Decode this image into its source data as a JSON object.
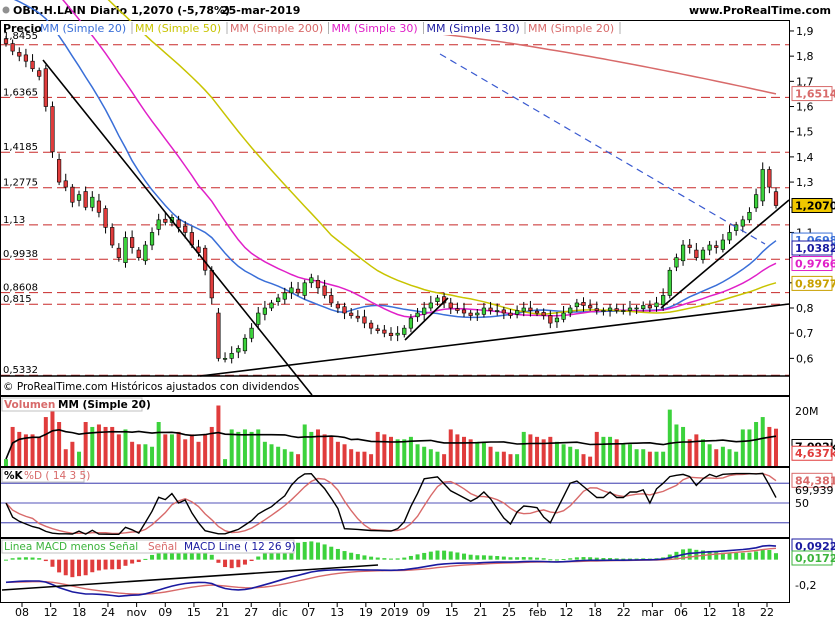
{
  "header": {
    "symbol": "OBR.H.LAIN",
    "period": "Diario",
    "last": "1,2070 (-5,78%)",
    "date": "25-mar-2019",
    "site": "www.ProRealTime.com"
  },
  "price_panel": {
    "title": "Precio",
    "legend": [
      {
        "label": "MM (Simple 20)",
        "color": "#3a6fd8"
      },
      {
        "label": "MM (Simple 50)",
        "color": "#c8c400"
      },
      {
        "label": "MM (Simple 200)",
        "color": "#d86a6a"
      },
      {
        "label": "MM (Simple 30)",
        "color": "#e020c8"
      },
      {
        "label": "MM (Simple 130)",
        "color": "#1a1aa0"
      },
      {
        "label": "MM (Simple 20)",
        "color": "#d86a6a"
      }
    ],
    "footer": "© ProRealTime.com  Históricos ajustados con dividendos",
    "axis_ticks": [
      "1,9",
      "1,8",
      "1,7",
      "1,6",
      "1,5",
      "1,4",
      "1,3",
      "1,2",
      "1,1",
      "1",
      "0,9",
      "0,8",
      "0,7",
      "0,6"
    ],
    "level_labels": [
      "1,6365",
      "1,4185",
      "1,2775",
      "1,13",
      "0,9938",
      "0,8608",
      "0,815",
      "0,5332"
    ],
    "level_partial": "1,8455",
    "tags": [
      {
        "text": "1,6514",
        "color": "#d86a6a",
        "fill": "#ffffff"
      },
      {
        "text": "1,2070",
        "color": "#000000",
        "fill": "#f0c800"
      },
      {
        "text": "1,0698",
        "color": "#3a6fd8",
        "fill": "#ffffff"
      },
      {
        "text": "1,0382",
        "color": "#1a1aa0",
        "fill": "#ffffff"
      },
      {
        "text": "0,9766",
        "color": "#e020c8",
        "fill": "#ffffff"
      },
      {
        "text": "0,8977",
        "color": "#c8a000",
        "fill": "#ffffff"
      }
    ]
  },
  "volume_panel": {
    "title": "Volumen",
    "legend": "MM (Simple 20)",
    "axis_ticks": [
      "20M",
      "7,092k",
      "4,637k"
    ]
  },
  "stoch_panel": {
    "title1": "%K",
    "title2": "%D ( 14 3 5)",
    "axis_ticks": [
      "84,381",
      "69,939",
      "50"
    ]
  },
  "macd_panel": {
    "title1": "Linea MACD menos Señal",
    "title2": "Señal",
    "title3": "MACD Line ( 12 26 9)",
    "axis_ticks": [
      "0,0922",
      "0,0172",
      "-0,2"
    ]
  },
  "x_axis": {
    "labels": [
      "08",
      "12",
      "18",
      "24",
      "nov",
      "09",
      "15",
      "21",
      "27",
      "dic",
      "07",
      "13",
      "19",
      "2019",
      "09",
      "15",
      "21",
      "25",
      "feb",
      "12",
      "18",
      "22",
      "mar",
      "06",
      "12",
      "18",
      "22"
    ]
  },
  "chart_data": {
    "type": "candlestick",
    "title": "OBR.H.LAIN Diario",
    "ylim": [
      0.53,
      1.88
    ],
    "n_sessions": 117,
    "closes": [
      1.85,
      1.82,
      1.8,
      1.78,
      1.75,
      1.72,
      1.6,
      1.42,
      1.3,
      1.28,
      1.22,
      1.25,
      1.2,
      1.24,
      1.18,
      1.12,
      1.05,
      1.0,
      1.08,
      1.04,
      1.0,
      1.05,
      1.1,
      1.15,
      1.14,
      1.16,
      1.12,
      1.1,
      1.05,
      1.02,
      0.95,
      0.84,
      0.6,
      0.6,
      0.62,
      0.64,
      0.68,
      0.72,
      0.78,
      0.8,
      0.82,
      0.84,
      0.86,
      0.88,
      0.86,
      0.9,
      0.92,
      0.88,
      0.85,
      0.82,
      0.8,
      0.78,
      0.77,
      0.76,
      0.74,
      0.72,
      0.71,
      0.7,
      0.69,
      0.7,
      0.72,
      0.76,
      0.78,
      0.8,
      0.82,
      0.84,
      0.82,
      0.8,
      0.79,
      0.78,
      0.77,
      0.78,
      0.8,
      0.79,
      0.79,
      0.78,
      0.77,
      0.79,
      0.8,
      0.79,
      0.78,
      0.77,
      0.74,
      0.76,
      0.78,
      0.8,
      0.82,
      0.81,
      0.8,
      0.79,
      0.79,
      0.8,
      0.79,
      0.79,
      0.8,
      0.8,
      0.81,
      0.8,
      0.82,
      0.85,
      0.95,
      1.0,
      1.05,
      1.04,
      1.0,
      1.03,
      1.05,
      1.04,
      1.07,
      1.1,
      1.13,
      1.15,
      1.18,
      1.25,
      1.35,
      1.28,
      1.207
    ],
    "moving_averages": [
      {
        "name": "MM (Simple 20)",
        "last": 1.0698
      },
      {
        "name": "MM (Simple 50)",
        "last": 0.8977
      },
      {
        "name": "MM (Simple 200)",
        "last": 1.6514
      },
      {
        "name": "MM (Simple 30)",
        "last": 0.9766
      },
      {
        "name": "MM (Simple 130)",
        "last": 1.0382
      }
    ],
    "horizontal_levels": [
      1.8455,
      1.6365,
      1.4185,
      1.2775,
      1.13,
      0.9938,
      0.8608,
      0.815,
      0.5332
    ],
    "last_close": 1.207,
    "change_pct": -5.78,
    "volume": {
      "ylim": [
        0,
        24000000
      ],
      "ma20_last": 7092000,
      "last": 4637000
    },
    "stochastic": {
      "k_last": 69.939,
      "d_last": 84.381,
      "levels": [
        80,
        50,
        20
      ]
    },
    "macd": {
      "histogram_last": 0.0172,
      "line_last": 0.0922,
      "signal_last": 0.075
    }
  }
}
